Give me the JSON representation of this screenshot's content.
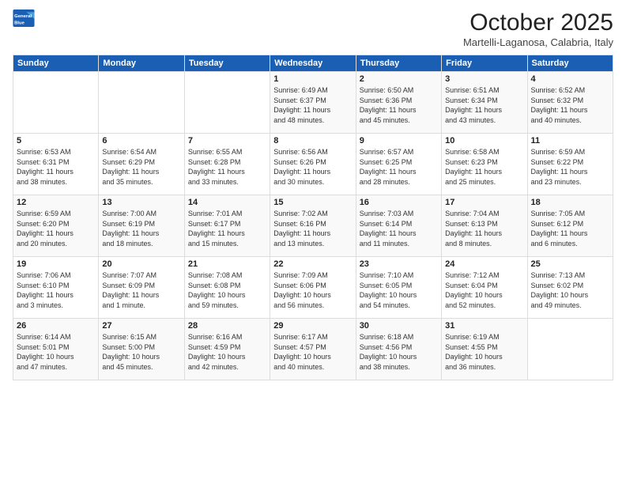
{
  "logo": {
    "line1": "General",
    "line2": "Blue"
  },
  "title": "October 2025",
  "subtitle": "Martelli-Laganosa, Calabria, Italy",
  "days_of_week": [
    "Sunday",
    "Monday",
    "Tuesday",
    "Wednesday",
    "Thursday",
    "Friday",
    "Saturday"
  ],
  "weeks": [
    [
      {
        "day": "",
        "info": ""
      },
      {
        "day": "",
        "info": ""
      },
      {
        "day": "",
        "info": ""
      },
      {
        "day": "1",
        "info": "Sunrise: 6:49 AM\nSunset: 6:37 PM\nDaylight: 11 hours\nand 48 minutes."
      },
      {
        "day": "2",
        "info": "Sunrise: 6:50 AM\nSunset: 6:36 PM\nDaylight: 11 hours\nand 45 minutes."
      },
      {
        "day": "3",
        "info": "Sunrise: 6:51 AM\nSunset: 6:34 PM\nDaylight: 11 hours\nand 43 minutes."
      },
      {
        "day": "4",
        "info": "Sunrise: 6:52 AM\nSunset: 6:32 PM\nDaylight: 11 hours\nand 40 minutes."
      }
    ],
    [
      {
        "day": "5",
        "info": "Sunrise: 6:53 AM\nSunset: 6:31 PM\nDaylight: 11 hours\nand 38 minutes."
      },
      {
        "day": "6",
        "info": "Sunrise: 6:54 AM\nSunset: 6:29 PM\nDaylight: 11 hours\nand 35 minutes."
      },
      {
        "day": "7",
        "info": "Sunrise: 6:55 AM\nSunset: 6:28 PM\nDaylight: 11 hours\nand 33 minutes."
      },
      {
        "day": "8",
        "info": "Sunrise: 6:56 AM\nSunset: 6:26 PM\nDaylight: 11 hours\nand 30 minutes."
      },
      {
        "day": "9",
        "info": "Sunrise: 6:57 AM\nSunset: 6:25 PM\nDaylight: 11 hours\nand 28 minutes."
      },
      {
        "day": "10",
        "info": "Sunrise: 6:58 AM\nSunset: 6:23 PM\nDaylight: 11 hours\nand 25 minutes."
      },
      {
        "day": "11",
        "info": "Sunrise: 6:59 AM\nSunset: 6:22 PM\nDaylight: 11 hours\nand 23 minutes."
      }
    ],
    [
      {
        "day": "12",
        "info": "Sunrise: 6:59 AM\nSunset: 6:20 PM\nDaylight: 11 hours\nand 20 minutes."
      },
      {
        "day": "13",
        "info": "Sunrise: 7:00 AM\nSunset: 6:19 PM\nDaylight: 11 hours\nand 18 minutes."
      },
      {
        "day": "14",
        "info": "Sunrise: 7:01 AM\nSunset: 6:17 PM\nDaylight: 11 hours\nand 15 minutes."
      },
      {
        "day": "15",
        "info": "Sunrise: 7:02 AM\nSunset: 6:16 PM\nDaylight: 11 hours\nand 13 minutes."
      },
      {
        "day": "16",
        "info": "Sunrise: 7:03 AM\nSunset: 6:14 PM\nDaylight: 11 hours\nand 11 minutes."
      },
      {
        "day": "17",
        "info": "Sunrise: 7:04 AM\nSunset: 6:13 PM\nDaylight: 11 hours\nand 8 minutes."
      },
      {
        "day": "18",
        "info": "Sunrise: 7:05 AM\nSunset: 6:12 PM\nDaylight: 11 hours\nand 6 minutes."
      }
    ],
    [
      {
        "day": "19",
        "info": "Sunrise: 7:06 AM\nSunset: 6:10 PM\nDaylight: 11 hours\nand 3 minutes."
      },
      {
        "day": "20",
        "info": "Sunrise: 7:07 AM\nSunset: 6:09 PM\nDaylight: 11 hours\nand 1 minute."
      },
      {
        "day": "21",
        "info": "Sunrise: 7:08 AM\nSunset: 6:08 PM\nDaylight: 10 hours\nand 59 minutes."
      },
      {
        "day": "22",
        "info": "Sunrise: 7:09 AM\nSunset: 6:06 PM\nDaylight: 10 hours\nand 56 minutes."
      },
      {
        "day": "23",
        "info": "Sunrise: 7:10 AM\nSunset: 6:05 PM\nDaylight: 10 hours\nand 54 minutes."
      },
      {
        "day": "24",
        "info": "Sunrise: 7:12 AM\nSunset: 6:04 PM\nDaylight: 10 hours\nand 52 minutes."
      },
      {
        "day": "25",
        "info": "Sunrise: 7:13 AM\nSunset: 6:02 PM\nDaylight: 10 hours\nand 49 minutes."
      }
    ],
    [
      {
        "day": "26",
        "info": "Sunrise: 6:14 AM\nSunset: 5:01 PM\nDaylight: 10 hours\nand 47 minutes."
      },
      {
        "day": "27",
        "info": "Sunrise: 6:15 AM\nSunset: 5:00 PM\nDaylight: 10 hours\nand 45 minutes."
      },
      {
        "day": "28",
        "info": "Sunrise: 6:16 AM\nSunset: 4:59 PM\nDaylight: 10 hours\nand 42 minutes."
      },
      {
        "day": "29",
        "info": "Sunrise: 6:17 AM\nSunset: 4:57 PM\nDaylight: 10 hours\nand 40 minutes."
      },
      {
        "day": "30",
        "info": "Sunrise: 6:18 AM\nSunset: 4:56 PM\nDaylight: 10 hours\nand 38 minutes."
      },
      {
        "day": "31",
        "info": "Sunrise: 6:19 AM\nSunset: 4:55 PM\nDaylight: 10 hours\nand 36 minutes."
      },
      {
        "day": "",
        "info": ""
      }
    ]
  ]
}
